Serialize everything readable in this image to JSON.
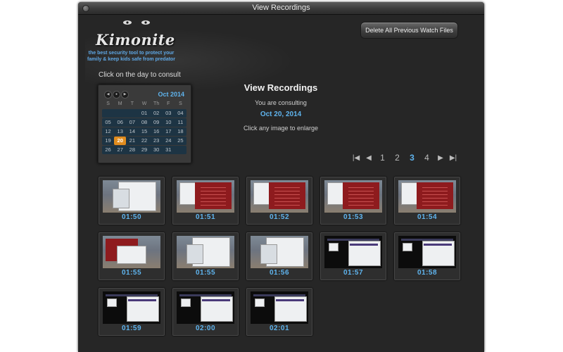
{
  "window": {
    "title": "View Recordings"
  },
  "branding": {
    "logo": "Kimonite",
    "tagline": "the best security tool to protect your family & keep kids safe from predator"
  },
  "instruction": "Click on the day to consult",
  "delete_button": "Delete All Previous Watch Files",
  "calendar": {
    "month": "Oct 2014",
    "weekday_headers": [
      "S",
      "M",
      "T",
      "W",
      "Th",
      "F",
      "S"
    ],
    "weeks": [
      [
        "",
        "",
        "",
        "01",
        "02",
        "03",
        "04"
      ],
      [
        "05",
        "06",
        "07",
        "08",
        "09",
        "10",
        "11"
      ],
      [
        "12",
        "13",
        "14",
        "15",
        "16",
        "17",
        "18"
      ],
      [
        "19",
        "20",
        "21",
        "22",
        "23",
        "24",
        "25"
      ],
      [
        "26",
        "27",
        "28",
        "29",
        "30",
        "31",
        ""
      ]
    ],
    "selected_day": "20"
  },
  "main": {
    "heading": "View Recordings",
    "consulting_label": "You are consulting",
    "date": "Oct 20, 2014",
    "hint": "Click any image to enlarge"
  },
  "pagination": {
    "pages": [
      "1",
      "2",
      "3",
      "4"
    ],
    "current": "3"
  },
  "colors": {
    "accent": "#5fb4ee",
    "selected_day": "#e08c1e",
    "background": "#262626"
  },
  "recordings": [
    {
      "time": "01:50",
      "preview": "desktop-browser"
    },
    {
      "time": "01:51",
      "preview": "red-site"
    },
    {
      "time": "01:52",
      "preview": "red-site"
    },
    {
      "time": "01:53",
      "preview": "red-site"
    },
    {
      "time": "01:54",
      "preview": "red-site"
    },
    {
      "time": "01:55",
      "preview": "desktop-red"
    },
    {
      "time": "01:55",
      "preview": "desktop-browser"
    },
    {
      "time": "01:56",
      "preview": "desktop-browser"
    },
    {
      "time": "01:57",
      "preview": "dark-browser"
    },
    {
      "time": "01:58",
      "preview": "dark-browser"
    },
    {
      "time": "01:59",
      "preview": "dark-browser"
    },
    {
      "time": "02:00",
      "preview": "dark-browser"
    },
    {
      "time": "02:01",
      "preview": "dark-browser"
    }
  ]
}
